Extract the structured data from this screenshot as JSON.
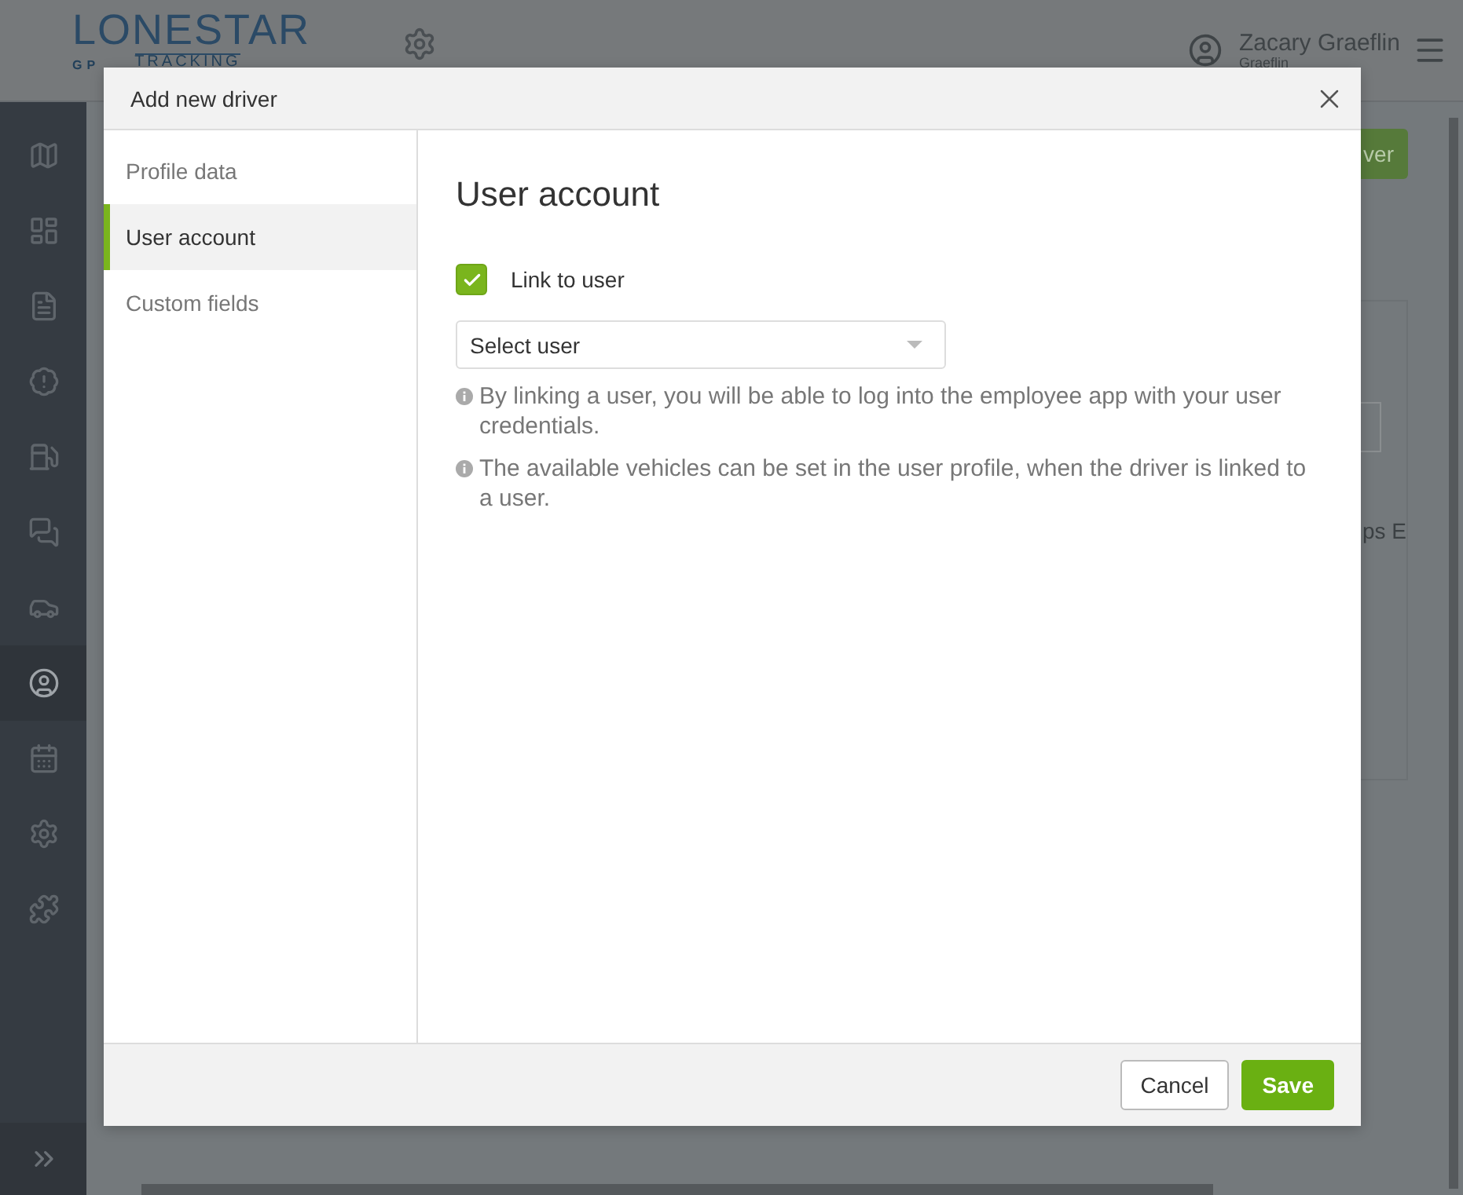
{
  "app": {
    "logo": {
      "name": "LONESTAR",
      "tagline": "TRACKING",
      "prefix": "GP"
    },
    "user": {
      "name": "Zacary Graeflin",
      "subtitle": "Graeflin"
    },
    "sidebar": {
      "items": [
        {
          "kind": "map",
          "selected": false
        },
        {
          "kind": "dashboard",
          "selected": false
        },
        {
          "kind": "document",
          "selected": false
        },
        {
          "kind": "alert",
          "selected": false
        },
        {
          "kind": "fuel",
          "selected": false
        },
        {
          "kind": "messages",
          "selected": false
        },
        {
          "kind": "car",
          "selected": false
        },
        {
          "kind": "user",
          "selected": true
        },
        {
          "kind": "calendar",
          "selected": false
        },
        {
          "kind": "settings",
          "selected": false
        },
        {
          "kind": "plugin",
          "selected": false
        }
      ]
    },
    "add_button": "ver",
    "table_fragment": "ps E"
  },
  "dialog": {
    "title": "Add new driver",
    "nav": [
      {
        "label": "Profile data",
        "selected": false
      },
      {
        "label": "User account",
        "selected": true
      },
      {
        "label": "Custom fields",
        "selected": false
      }
    ],
    "heading": "User account",
    "link_to_user": {
      "label": "Link to user",
      "checked": true
    },
    "user_select": {
      "placeholder": "Select user"
    },
    "hints": [
      "By linking a user, you will be able to log into the employee app with your user credentials.",
      "The available vehicles can be set in the user profile, when the driver is linked to a user."
    ],
    "buttons": {
      "cancel": "Cancel",
      "save": "Save"
    }
  }
}
